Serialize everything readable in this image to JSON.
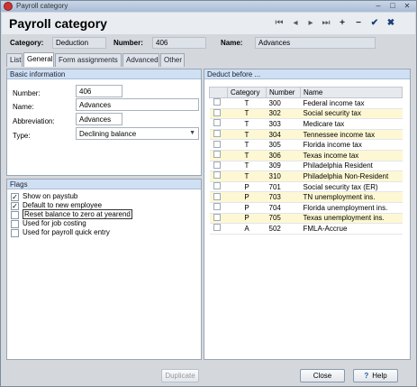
{
  "window": {
    "title": "Payroll category"
  },
  "header": {
    "title": "Payroll category"
  },
  "info": {
    "category_label": "Category:",
    "category_value": "Deduction",
    "number_label": "Number:",
    "number_value": "406",
    "name_label": "Name:",
    "name_value": "Advances"
  },
  "tabs": [
    "List",
    "General",
    "Form assignments",
    "Advanced",
    "Other"
  ],
  "basic": {
    "title": "Basic information",
    "number_label": "Number:",
    "number_value": "406",
    "name_label": "Name:",
    "name_value": "Advances",
    "abbr_label": "Abbreviation:",
    "abbr_value": "Advances",
    "type_label": "Type:",
    "type_value": "Declining balance"
  },
  "flags": {
    "title": "Flags",
    "items": [
      {
        "label": "Show on paystub",
        "checked": true
      },
      {
        "label": "Default to new employee",
        "checked": true
      },
      {
        "label": "Reset balance to zero at yearend",
        "checked": false
      },
      {
        "label": "Used for job costing",
        "checked": false
      },
      {
        "label": "Used for payroll quick entry",
        "checked": false
      }
    ]
  },
  "deduct": {
    "title": "Deduct before ...",
    "columns": [
      "Category",
      "Number",
      "Name"
    ],
    "rows": [
      {
        "category": "T",
        "number": "300",
        "name": "Federal income tax"
      },
      {
        "category": "T",
        "number": "302",
        "name": "Social security tax"
      },
      {
        "category": "T",
        "number": "303",
        "name": "Medicare tax"
      },
      {
        "category": "T",
        "number": "304",
        "name": "Tennessee income tax"
      },
      {
        "category": "T",
        "number": "305",
        "name": "Florida income tax"
      },
      {
        "category": "T",
        "number": "306",
        "name": "Texas income tax"
      },
      {
        "category": "T",
        "number": "309",
        "name": "Philadelphia Resident"
      },
      {
        "category": "T",
        "number": "310",
        "name": "Philadelphia Non-Resident"
      },
      {
        "category": "P",
        "number": "701",
        "name": "Social security tax (ER)"
      },
      {
        "category": "P",
        "number": "703",
        "name": "TN unemployment ins."
      },
      {
        "category": "P",
        "number": "704",
        "name": "Florida unemployment ins."
      },
      {
        "category": "P",
        "number": "705",
        "name": "Texas unemployment ins."
      },
      {
        "category": "A",
        "number": "502",
        "name": "FMLA-Accrue"
      }
    ]
  },
  "buttons": {
    "duplicate": "Duplicate",
    "close": "Close",
    "help": "Help"
  },
  "colors": {
    "title_bar": "#b7c8df",
    "panel_header": "#cfe0f4",
    "alt_row": "#fdf8d3"
  }
}
